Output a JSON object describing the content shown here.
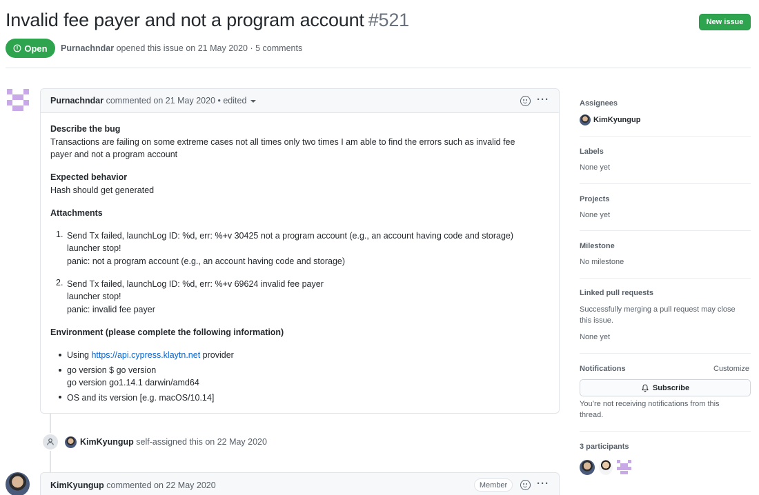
{
  "issue": {
    "title": "Invalid fee payer and not a program account",
    "number": "#521",
    "state": "Open",
    "author": "Purnachndar",
    "opened_text": "opened this issue on 21 May 2020 · 5 comments",
    "new_issue_label": "New issue"
  },
  "comment1": {
    "author": "Purnachndar",
    "meta": "commented on 21 May 2020 • edited",
    "describe_heading": "Describe the bug",
    "describe_line1": "Transactions are failing on some extreme cases not all times only two times I am able to find the errors such as invalid fee",
    "describe_line2": "payer and not a program account",
    "expected_heading": "Expected behavior",
    "expected_text": "Hash should get generated",
    "attachments_heading": "Attachments",
    "list1": {
      "num": "1.",
      "line1": "Send Tx failed, launchLog ID: %d, err: %+v 30425 not a program account (e.g., an account having code and storage)",
      "line2": "launcher stop!",
      "line3": "panic: not a program account (e.g., an account having code and storage)"
    },
    "list2": {
      "num": "2.",
      "line1": "Send Tx failed, launchLog ID: %d, err: %+v 69624 invalid fee payer",
      "line2": "launcher stop!",
      "line3": "panic: invalid fee payer"
    },
    "env_heading": "Environment (please complete the following information)",
    "env1_prefix": "Using",
    "env1_link": "https://api.cypress.klaytn.net",
    "env1_suffix": "provider",
    "env2_line1": "go version $ go version",
    "env2_line2": "go version go1.14.1 darwin/amd64",
    "env3": "OS and its version [e.g. macOS/10.14]"
  },
  "timeline_event": {
    "user": "KimKyungup",
    "text": "self-assigned this on 22 May 2020"
  },
  "comment2": {
    "author": "KimKyungup",
    "meta": "commented on 22 May 2020",
    "badge": "Member"
  },
  "sidebar": {
    "assignees_heading": "Assignees",
    "assignee": "KimKyungup",
    "labels_heading": "Labels",
    "labels_value": "None yet",
    "projects_heading": "Projects",
    "projects_value": "None yet",
    "milestone_heading": "Milestone",
    "milestone_value": "No milestone",
    "linked_heading": "Linked pull requests",
    "linked_line1": "Successfully merging a pull request may close",
    "linked_line2": "this issue.",
    "linked_value": "None yet",
    "notifications_heading": "Notifications",
    "customize": "Customize",
    "subscribe": "Subscribe",
    "notif_line1": "You’re not receiving notifications from this",
    "notif_line2": "thread.",
    "participants_heading": "3 participants"
  },
  "colors": {
    "open_green": "#2ea44f",
    "link_blue": "#0366d6",
    "identicon_purple": "#c9a8e8"
  }
}
